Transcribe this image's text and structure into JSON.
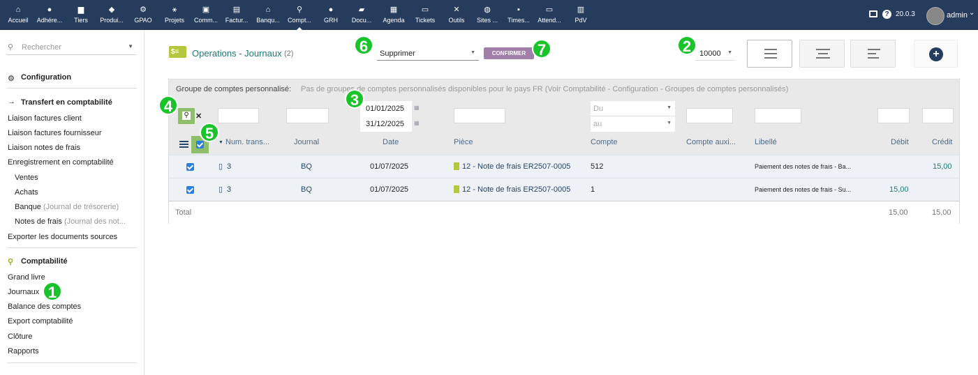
{
  "topbar": {
    "items": [
      {
        "label": "Accueil",
        "icon": "home-icon",
        "glyph": "⌂"
      },
      {
        "label": "Adhére...",
        "icon": "user-icon",
        "glyph": "●"
      },
      {
        "label": "Tiers",
        "icon": "building-icon",
        "glyph": "▆"
      },
      {
        "label": "Produi...",
        "icon": "cube-icon",
        "glyph": "◆"
      },
      {
        "label": "GPAO",
        "icon": "cogs-icon",
        "glyph": "⚙"
      },
      {
        "label": "Projets",
        "icon": "project-icon",
        "glyph": "⚹"
      },
      {
        "label": "Comm...",
        "icon": "briefcase-icon",
        "glyph": "▣"
      },
      {
        "label": "Factur...",
        "icon": "invoice-icon",
        "glyph": "▤"
      },
      {
        "label": "Banqu...",
        "icon": "bank-icon",
        "glyph": "⌂"
      },
      {
        "label": "Compt...",
        "icon": "search-dollar-icon",
        "glyph": "⚲"
      },
      {
        "label": "GRH",
        "icon": "user-tie-icon",
        "glyph": "●"
      },
      {
        "label": "Docu...",
        "icon": "folder-icon",
        "glyph": "▰"
      },
      {
        "label": "Agenda",
        "icon": "calendar-icon",
        "glyph": "▦"
      },
      {
        "label": "Tickets",
        "icon": "ticket-icon",
        "glyph": "▭"
      },
      {
        "label": "Outils",
        "icon": "tools-icon",
        "glyph": "✕"
      },
      {
        "label": "Sites ...",
        "icon": "globe-icon",
        "glyph": "◍"
      },
      {
        "label": "Times...",
        "icon": "note-icon",
        "glyph": "▪"
      },
      {
        "label": "Attend...",
        "icon": "id-card-icon",
        "glyph": "▭"
      },
      {
        "label": "PdV",
        "icon": "cash-register-icon",
        "glyph": "▥"
      }
    ],
    "version": "20.0.3",
    "user": "admin"
  },
  "sidebar": {
    "search_placeholder": "Rechercher",
    "config": "Configuration",
    "transfer": "Transfert en comptabilité",
    "items1": [
      "Liaison factures client",
      "Liaison factures fournisseur",
      "Liaison notes de frais",
      "Enregistrement en comptabilité"
    ],
    "sub": [
      {
        "label": "Ventes",
        "extra": ""
      },
      {
        "label": "Achats",
        "extra": ""
      },
      {
        "label": "Banque",
        "extra": "(Journal de trésorerie)"
      },
      {
        "label": "Notes de frais",
        "extra": "(Journal des not..."
      }
    ],
    "export_docs": "Exporter les documents sources",
    "compta": "Comptabilité",
    "items2": [
      "Grand livre",
      "Journaux",
      "Balance des comptes",
      "Export comptabilité",
      "Clôture",
      "Rapports"
    ]
  },
  "main": {
    "title": "Operations - Journaux",
    "count": "(2)",
    "action_select": "Supprimer",
    "confirm": "CONFIRMER",
    "limit": "10000",
    "group_label": "Groupe de comptes personnalisé:",
    "group_text": "Pas de groupes de comptes personnalisés disponibles pour le pays FR (Voir Comptabilité - Configuration - Groupes de comptes personnalisés)",
    "date_from": "01/01/2025",
    "date_to": "31/12/2025",
    "compte_du": "Du",
    "compte_au": "au",
    "headers": [
      "Num. trans...",
      "Journal",
      "Date",
      "Pièce",
      "Compte",
      "Compte auxi...",
      "Libellé",
      "Débit",
      "Crédit"
    ],
    "rows": [
      {
        "num": "3",
        "journal": "BQ",
        "date": "01/07/2025",
        "piece": "12 - Note de frais ER2507-0005",
        "compte": "512",
        "aux": "",
        "libelle": "Paiement des notes de frais - Ba...",
        "debit": "",
        "credit": "15,00"
      },
      {
        "num": "3",
        "journal": "BQ",
        "date": "01/07/2025",
        "piece": "12 - Note de frais ER2507-0005",
        "compte": "1",
        "aux": "",
        "libelle": "Paiement des notes de frais - Su...",
        "debit": "15,00",
        "credit": ""
      }
    ],
    "total_label": "Total",
    "total_debit": "15,00",
    "total_credit": "15,00"
  },
  "markers": [
    "1",
    "2",
    "3",
    "4",
    "5",
    "6",
    "7"
  ],
  "colors": {
    "topbar": "#263c5c",
    "accent": "#19c42a",
    "confirm": "#a27fa9"
  }
}
